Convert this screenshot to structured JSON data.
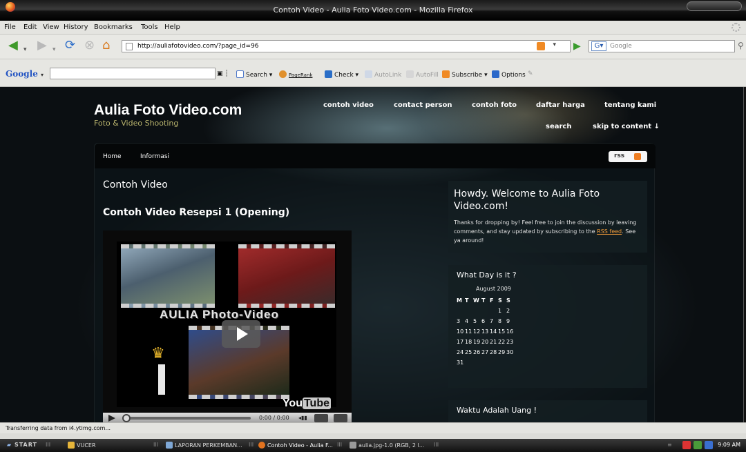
{
  "window": {
    "title": "Contoh Video - Aulia Foto Video.com - Mozilla Firefox"
  },
  "menu": [
    "File",
    "Edit",
    "View",
    "History",
    "Bookmarks",
    "Tools",
    "Help"
  ],
  "nav": {
    "url": "http://auliafotovideo.com/?page_id=96",
    "search_placeholder": "Google"
  },
  "gtoolbar": {
    "logo": "Google",
    "items": [
      "Search",
      "PageRank",
      "Check",
      "AutoLink",
      "AutoFill",
      "Subscribe",
      "Options"
    ]
  },
  "site": {
    "title": "Aulia Foto Video.com",
    "tagline": "Foto & Video Shooting",
    "topnav_row1": [
      "contoh video",
      "contact person",
      "contoh foto",
      "daftar harga",
      "tentang kami"
    ],
    "topnav_row2": [
      "search",
      "skip to content ↓"
    ],
    "subnav": [
      "Home",
      "Informasi"
    ],
    "rss": "rss"
  },
  "main": {
    "page_heading": "Contoh Video",
    "post_title": "Contoh Video Resepsi 1 (Opening)",
    "video": {
      "logo_text": "AULIA Photo-Video",
      "time": "0:00 / 0:00",
      "brand_you": "You",
      "brand_tube": "Tube"
    }
  },
  "sidebar": {
    "welcome": {
      "heading": "Howdy. Welcome to Aulia Foto Video.com!",
      "text_before": "Thanks for dropping by! Feel free to join the discussion by leaving comments, and stay updated by subscribing to the ",
      "link": "RSS feed",
      "text_after": ". See ya around!"
    },
    "calendar": {
      "heading": "What Day is it ?",
      "month": "August 2009",
      "days": [
        "M",
        "T",
        "W",
        "T",
        "F",
        "S",
        "S"
      ],
      "weeks": [
        [
          "",
          "",
          "",
          "",
          "",
          "1",
          "2"
        ],
        [
          "3",
          "4",
          "5",
          "6",
          "7",
          "8",
          "9"
        ],
        [
          "10",
          "11",
          "12",
          "13",
          "14",
          "15",
          "16"
        ],
        [
          "17",
          "18",
          "19",
          "20",
          "21",
          "22",
          "23"
        ],
        [
          "24",
          "25",
          "26",
          "27",
          "28",
          "29",
          "30"
        ],
        [
          "31",
          "",
          "",
          "",
          "",
          "",
          ""
        ]
      ]
    },
    "money": {
      "heading": "Waktu Adalah Uang !"
    }
  },
  "status": "Transferring data from i4.ytimg.com...",
  "taskbar": {
    "start": "START",
    "tasks": [
      "VUCER",
      "LAPORAN PERKEMBAN...",
      "Contoh Video - Aulia F...",
      "aulia.jpg-1.0 (RGB, 2 l..."
    ],
    "clock": "9:09 AM"
  }
}
